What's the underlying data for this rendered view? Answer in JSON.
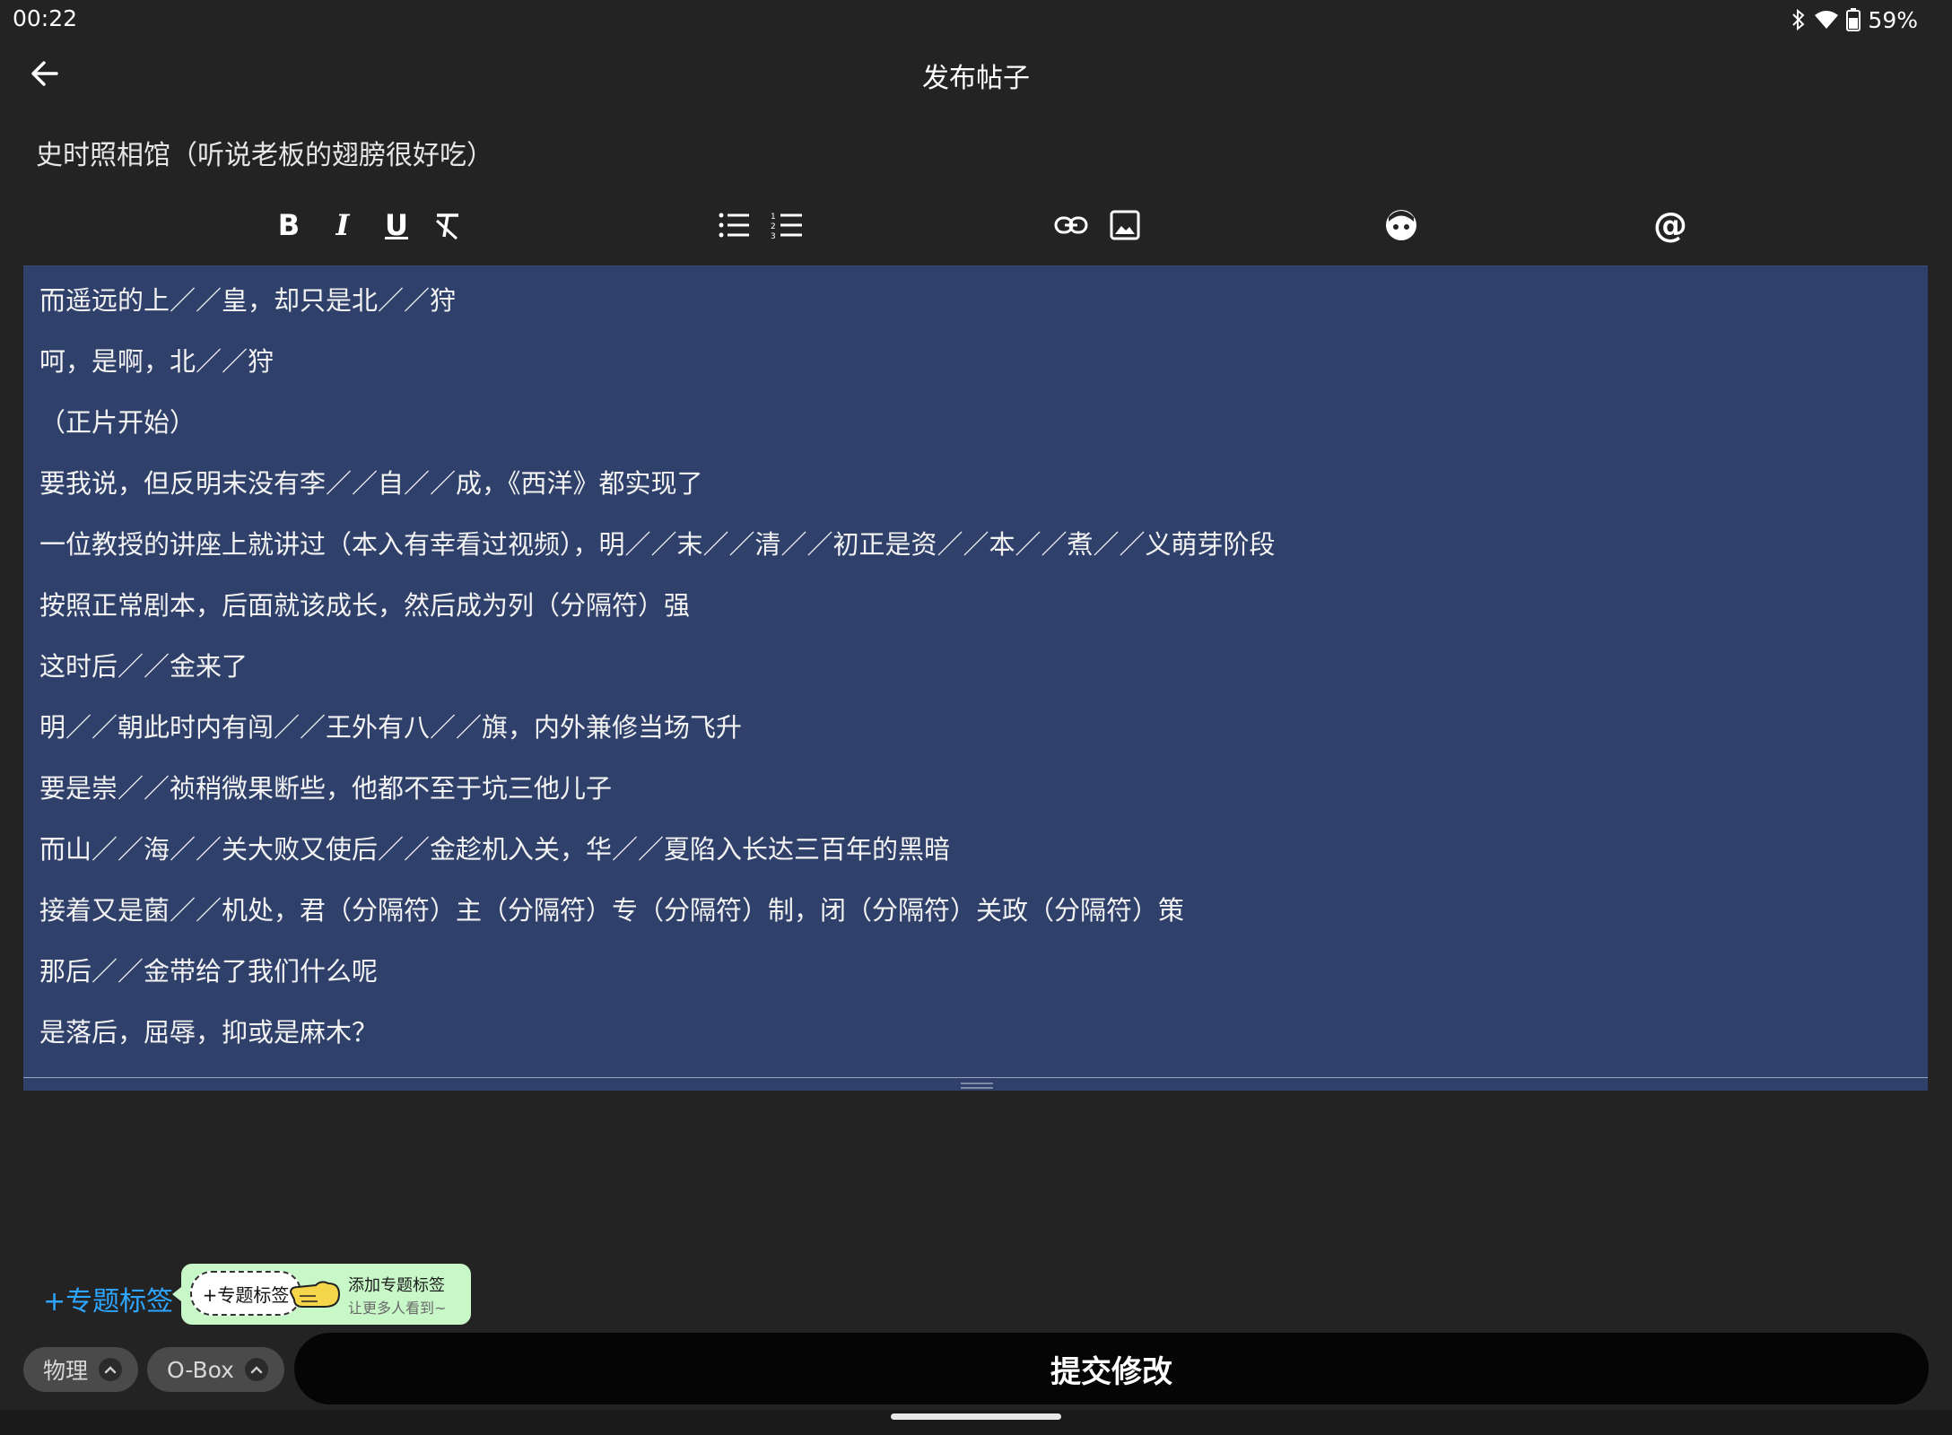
{
  "status_bar": {
    "time": "00:22",
    "battery_text": "59%",
    "icons": [
      "bluetooth-icon",
      "wifi-icon",
      "battery-icon"
    ]
  },
  "header": {
    "back_icon": "arrow-left-icon",
    "title": "发布帖子"
  },
  "post": {
    "title": "史时照相馆（听说老板的翅膀很好吃）"
  },
  "toolbar": {
    "buttons": [
      "bold-icon",
      "italic-icon",
      "underline-icon",
      "clear-format-icon",
      "bulleted-list-icon",
      "numbered-list-icon",
      "link-icon",
      "image-icon",
      "emoji-icon",
      "at-mention-icon"
    ],
    "bold_label": "B",
    "italic_label": "I",
    "underline_label": "U",
    "mention_label": "@"
  },
  "editor": {
    "lines": [
      "而遥远的上／／皇，却只是北／／狩",
      "呵，是啊，北／／狩",
      "（正片开始）",
      "要我说，但反明末没有李／／自／／成，《西洋》都实现了",
      "一位教授的讲座上就讲过（本入有幸看过视频），明／／末／／清／／初正是资／／本／／煮／／义萌芽阶段",
      "按照正常剧本，后面就该成长，然后成为列（分隔符）强",
      "这时后／／金来了",
      "明／／朝此时内有闯／／王外有八／／旗，内外兼修当场飞升",
      "要是崇／／祯稍微果断些，他都不至于坑三他儿子",
      "而山／／海／／关大败又使后／／金趁机入关，华／／夏陷入长达三百年的黑暗",
      "接着又是菌／／机处，君（分隔符）主（分隔符）专（分隔符）制，闭（分隔符）关政（分隔符）策",
      "那后／／金带给了我们什么呢",
      "是落后，屈辱，抑或是麻木？"
    ]
  },
  "topic": {
    "link_label": "+专题标签",
    "tip_chip_label": "+专题标签",
    "tip_title": "添加专题标签",
    "tip_subtitle": "让更多人看到~"
  },
  "tags": [
    {
      "label": "物理"
    },
    {
      "label": "O-Box"
    }
  ],
  "submit": {
    "label": "提交修改"
  },
  "colors": {
    "background": "#232323",
    "editor_bg": "#2f406a",
    "accent_link": "#2ea6ff",
    "tip_bg": "#c8f7c8",
    "submit_bg": "#050505"
  }
}
